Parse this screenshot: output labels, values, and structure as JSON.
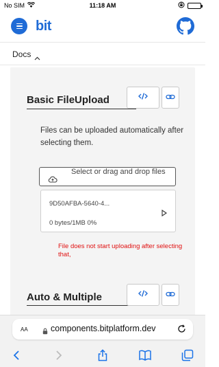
{
  "status_bar": {
    "carrier": "No SIM",
    "time": "11:18 AM"
  },
  "header": {
    "logo": "bit"
  },
  "docs_bar": {
    "label": "Docs"
  },
  "sections": [
    {
      "title": "Basic FileUpload",
      "description": "Files can be uploaded automatically after selecting them.",
      "upload_button_label": "Select or drag and drop files",
      "file": {
        "name": "9D50AFBA-5640-4...",
        "progress": "0 bytes/1MB  0%"
      },
      "error": "File does not start uploading after selecting that,"
    },
    {
      "title": "Auto & Multiple"
    }
  ],
  "browser": {
    "aa": "AA",
    "url": "components.bitplatform.dev"
  },
  "colors": {
    "accent": "#1f6bd6",
    "error": "#e01010",
    "panel": "#f4f4f4"
  },
  "icons": [
    "wifi-icon",
    "battery-icon",
    "menu-icon",
    "github-icon",
    "chevron-up-icon",
    "code-icon",
    "link-icon",
    "cloud-upload-icon",
    "play-icon",
    "lock-icon",
    "reload-icon",
    "back-icon",
    "forward-icon",
    "share-icon",
    "bookmarks-icon",
    "tabs-icon"
  ]
}
